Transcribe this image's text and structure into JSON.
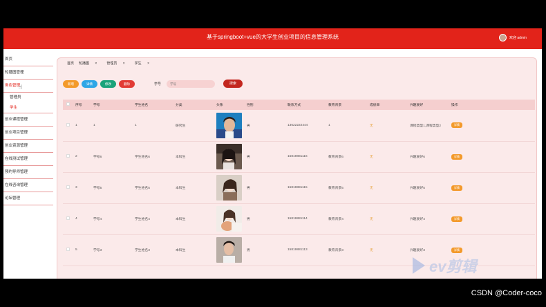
{
  "header": {
    "title": "基于springboot+vue的大学生创业项目的信息管理系统",
    "user": "欢迎 admin"
  },
  "sidebar": {
    "items": [
      {
        "label": "首页"
      },
      {
        "label": "轮播图管理"
      },
      {
        "label": "角色管理",
        "active": true,
        "children": [
          {
            "label": "管理员"
          },
          {
            "label": "学生",
            "active": true
          }
        ]
      },
      {
        "label": "创业课程管理"
      },
      {
        "label": "创业项目管理"
      },
      {
        "label": "创业资源管理"
      },
      {
        "label": "在线测试管理"
      },
      {
        "label": "预约导师管理"
      },
      {
        "label": "在线咨询管理"
      },
      {
        "label": "论坛管理"
      }
    ]
  },
  "breadcrumbs": [
    "首页",
    "轮播图",
    "管理员",
    "学生"
  ],
  "actions": {
    "add": "新增",
    "detail": "详情",
    "edit": "修改",
    "delete": "删除",
    "search_label": "学号",
    "search_placeholder": "学号",
    "search_button": "搜索",
    "colors": {
      "add": "#f39a2b",
      "detail": "#2ea6e6",
      "edit": "#1aa37a",
      "delete": "#e23b35"
    }
  },
  "table": {
    "columns": [
      "序号",
      "学号",
      "学生姓名",
      "分类",
      "头像",
      "性别",
      "联系方式",
      "教育背景",
      "成绩单",
      "兴趣爱好",
      "操作"
    ],
    "rows": [
      {
        "no": "1",
        "student_id": "1",
        "name": "1",
        "category": "研究生",
        "gender": "男",
        "phone": "13622222444",
        "education": "1",
        "grade": "无",
        "interest": "课程类型1,课程类型2",
        "op": "详情"
      },
      {
        "no": "2",
        "student_id": "学号6",
        "name": "学生姓名6",
        "category": "本科生",
        "gender": "男",
        "phone": "15819881116",
        "education": "教育背景6",
        "grade": "无",
        "interest": "兴趣爱好6",
        "op": "详情"
      },
      {
        "no": "3",
        "student_id": "学号5",
        "name": "学生姓名5",
        "category": "本科生",
        "gender": "男",
        "phone": "15819881115",
        "education": "教育背景5",
        "grade": "无",
        "interest": "兴趣爱好5",
        "op": "详情"
      },
      {
        "no": "4",
        "student_id": "学号4",
        "name": "学生姓名4",
        "category": "本科生",
        "gender": "男",
        "phone": "15819881114",
        "education": "教育背景4",
        "grade": "无",
        "interest": "兴趣爱好4",
        "op": "详情"
      },
      {
        "no": "5",
        "student_id": "学号3",
        "name": "学生姓名3",
        "category": "本科生",
        "gender": "男",
        "phone": "15819881113",
        "education": "教育背景3",
        "grade": "无",
        "interest": "兴趣爱好3",
        "op": "详情"
      }
    ]
  },
  "watermark": "ev剪辑",
  "credit": "CSDN @Coder-coco"
}
